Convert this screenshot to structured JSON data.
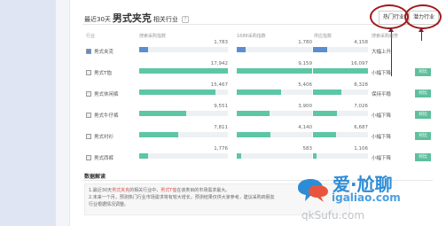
{
  "header": {
    "title_prefix": "最近30天",
    "keyword": "男式夹克",
    "title_suffix": "相关行业",
    "help_icon": "?"
  },
  "tabs": [
    {
      "label": "热门行业",
      "name": "tab-hot-industry",
      "active": true
    },
    {
      "label": "潜力行业",
      "name": "tab-potential-industry",
      "active": false
    }
  ],
  "columns": {
    "industry": "行业",
    "m1": "搜索采购指数",
    "m2": "1688采购指数",
    "m3": "供应指数",
    "m4": "搜索采购趋势"
  },
  "rows": [
    {
      "name": "男式夹克",
      "checked": true,
      "m1": "1,783",
      "m1_fill": 0.1,
      "m2": "1,780",
      "m2_fill": 0.12,
      "m3": "4,158",
      "m3_fill": 0.25,
      "trend": "大幅上升",
      "action": "",
      "primary": true
    },
    {
      "name": "男式T恤",
      "checked": false,
      "m1": "17,942",
      "m1_fill": 1.0,
      "m2": "9,159",
      "m2_fill": 1.0,
      "m3": "16,097",
      "m3_fill": 1.0,
      "trend": "小幅下降",
      "action": "对比",
      "primary": false
    },
    {
      "name": "男式休闲裤",
      "checked": false,
      "m1": "15,467",
      "m1_fill": 0.86,
      "m2": "5,406",
      "m2_fill": 0.59,
      "m3": "8,328",
      "m3_fill": 0.52,
      "trend": "保持平稳",
      "action": "对比",
      "primary": false
    },
    {
      "name": "男式牛仔裤",
      "checked": false,
      "m1": "9,551",
      "m1_fill": 0.53,
      "m2": "3,900",
      "m2_fill": 0.43,
      "m3": "7,026",
      "m3_fill": 0.44,
      "trend": "小幅下降",
      "action": "对比",
      "primary": false
    },
    {
      "name": "男式衬衫",
      "checked": false,
      "m1": "7,811",
      "m1_fill": 0.44,
      "m2": "4,140",
      "m2_fill": 0.45,
      "m3": "6,687",
      "m3_fill": 0.42,
      "trend": "小幅下降",
      "action": "对比",
      "primary": false
    },
    {
      "name": "男式西裤",
      "checked": false,
      "m1": "1,776",
      "m1_fill": 0.1,
      "m2": "583",
      "m2_fill": 0.06,
      "m3": "1,106",
      "m3_fill": 0.07,
      "trend": "小幅下降",
      "action": "对比",
      "primary": false
    }
  ],
  "analysis": {
    "title": "数据解读",
    "line1_a": "1.最近30天",
    "line1_kw": "男式夹克",
    "line1_b": "的相关行业中，",
    "line1_kw2": "男式T恤",
    "line1_c": "在该类目的市场需求最大。",
    "line2": "2.未来一个月，预测热门行业市场需求将有较大增长，预测结果仅供大家参考，建议采购商朋友",
    "line3": "行业根据情况调整。"
  },
  "watermark": {
    "logo": "爱·尬聊",
    "url": "igaliao.com",
    "url2": "qkSufu.com"
  },
  "colors": {
    "bar_green": "#5dc6a4",
    "bar_blue": "#5b8ed0",
    "annotation_red": "#a11a1a"
  }
}
